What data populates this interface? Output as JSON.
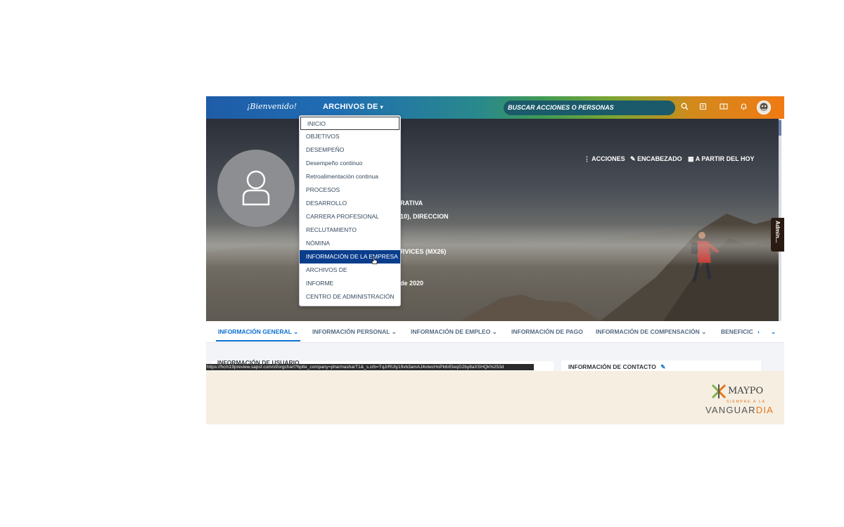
{
  "topbar": {
    "welcome": "¡Bienvenido!",
    "module_menu": "ARCHIVOS DE",
    "search_placeholder": "BUSCAR ACCIONES O PERSONAS",
    "icons": [
      "search-icon",
      "notes-icon",
      "layout-icon",
      "bell-icon",
      "avatar"
    ]
  },
  "dropdown": {
    "items": [
      "INICIO",
      "OBJETIVOS",
      "DESEMPEÑO",
      "Desempeño continuo",
      "Retroalimentación continua",
      "PROCESOS",
      "DESARROLLO",
      "CARRERA PROFESIONAL",
      "RECLUTAMIENTO",
      "NÓMINA",
      "INFORMACIÓN DE LA EMPRESA",
      "ARCHIVOS DE",
      "INFORME",
      "CENTRO DE ADMINISTRACIÓN"
    ],
    "selected_index": 10,
    "highlighted_index": 0
  },
  "hero": {
    "actions_label": "ACCIONES",
    "header_label": "ENCABEZADO",
    "date_label": "A PARTIR DEL HOY",
    "line1": "RATIVA",
    "line2": "10), DIRECCION",
    "line3": "RVICES (MX26)",
    "line4": "de 2020",
    "side_tab": "Admin..."
  },
  "tabs": [
    "INFORMACIÓN GENERAL",
    "INFORMACIÓN PERSONAL",
    "INFORMACIÓN DE EMPLEO",
    "INFORMACIÓN DE PAGO",
    "INFORMACIÓN DE COMPENSACIÓN",
    "BENEFICIC"
  ],
  "content": {
    "user_info_title": "INFORMACIÓN DE USUARIO",
    "contact_title": "INFORMACIÓN DE CONTACTO",
    "status_url": "https://hcm19preview.sapsf.com/sf/orgchart?bplte_company=pharmasharT1&_s.crb=TqJrRUty19vb3amAJ4vIwcHoPk6rEleqG2by8aXSHQk%253d"
  },
  "footer": {
    "brand": "MAYPO",
    "tagline": "SIEMPRE A LA",
    "slogan_part1": "VANGUAR",
    "slogan_part2": "DIA",
    "colors": {
      "brand_orange": "#e4751f",
      "brand_green": "#7ab648",
      "brand_gray": "#555555"
    }
  },
  "colors": {
    "selected_item_bg": "#0a3e8c",
    "active_tab": "#0a6ed1",
    "menu_text": "#354a5f"
  }
}
